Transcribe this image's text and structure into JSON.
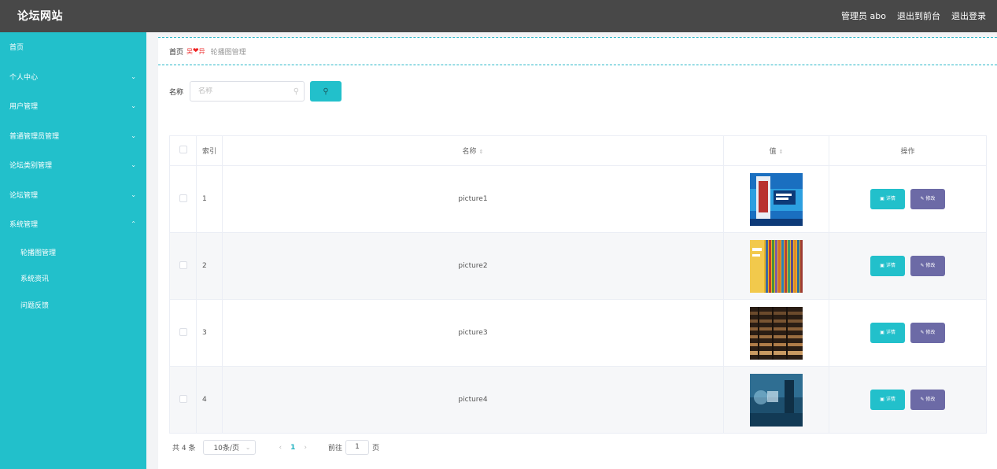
{
  "header": {
    "brand": "论坛网站",
    "admin_label": "管理员 abo",
    "back_to_front": "退出到前台",
    "logout": "退出登录"
  },
  "sidebar": {
    "items": [
      {
        "label": "首页",
        "chevron": ""
      },
      {
        "label": "个人中心",
        "chevron": "⌄"
      },
      {
        "label": "用户管理",
        "chevron": "⌄"
      },
      {
        "label": "普通管理员管理",
        "chevron": "⌄"
      },
      {
        "label": "论坛类别管理",
        "chevron": "⌄"
      },
      {
        "label": "论坛管理",
        "chevron": "⌄"
      },
      {
        "label": "系统管理",
        "chevron": "⌃"
      }
    ],
    "sub_items": [
      {
        "label": "轮播图管理"
      },
      {
        "label": "系统资讯"
      },
      {
        "label": "问题反馈"
      }
    ]
  },
  "breadcrumb": {
    "home": "首页",
    "sep_left": "吴",
    "sep_heart": "❤",
    "sep_right": "异",
    "current": "轮播图管理"
  },
  "search": {
    "label": "名称",
    "placeholder": "名称",
    "value": ""
  },
  "table": {
    "headers": {
      "index": "索引",
      "name": "名称",
      "value": "值",
      "ops": "操作"
    },
    "rows": [
      {
        "index": "1",
        "name": "picture1",
        "detail": "详情",
        "edit": "修改"
      },
      {
        "index": "2",
        "name": "picture2",
        "detail": "详情",
        "edit": "修改"
      },
      {
        "index": "3",
        "name": "picture3",
        "detail": "详情",
        "edit": "修改"
      },
      {
        "index": "4",
        "name": "picture4",
        "detail": "详情",
        "edit": "修改"
      }
    ]
  },
  "pagination": {
    "total": "共 4 条",
    "page_size": "10条/页",
    "current_page": "1",
    "goto_label": "前往",
    "goto_value": "1",
    "page_unit": "页"
  },
  "colors": {
    "accent": "#22c0cb",
    "topbar": "#484848",
    "edit_button": "#6c6aa6"
  }
}
